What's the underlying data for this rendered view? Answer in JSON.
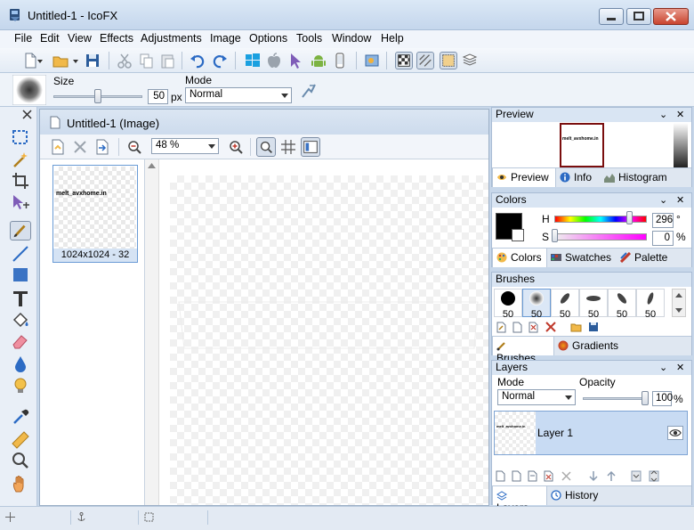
{
  "window": {
    "title": "Untitled-1 - IcoFX"
  },
  "menu": [
    "File",
    "Edit",
    "View",
    "Effects",
    "Adjustments",
    "Image",
    "Options",
    "Tools",
    "Window",
    "Help"
  ],
  "options": {
    "size_label": "Size",
    "size_value": "50",
    "size_unit": "px",
    "mode_label": "Mode",
    "mode_value": "Normal"
  },
  "document": {
    "title": "Untitled-1 (Image)",
    "zoom": "48 %",
    "thumb_caption": "1024x1024 - 32",
    "watermark": "melt_avxhome.in"
  },
  "preview": {
    "title": "Preview",
    "tabs": [
      "Preview",
      "Info",
      "Histogram"
    ],
    "watermark": "melt_avxhome.in"
  },
  "colors": {
    "title": "Colors",
    "h_label": "H",
    "h_value": "296",
    "h_unit": "°",
    "s_label": "S",
    "s_value": "0",
    "s_unit": "%",
    "tabs": [
      "Colors",
      "Swatches",
      "Palette"
    ],
    "primary": "#000000"
  },
  "brushes": {
    "title": "Brushes",
    "sizes": [
      "50",
      "50",
      "50",
      "50",
      "50",
      "50"
    ],
    "tabs": [
      "Brushes",
      "Gradients"
    ]
  },
  "layers": {
    "title": "Layers",
    "mode_label": "Mode",
    "mode_value": "Normal",
    "opacity_label": "Opacity",
    "opacity_value": "100",
    "opacity_unit": "%",
    "items": [
      {
        "name": "Layer 1",
        "thumb_text": "melt_avxhome.in"
      }
    ],
    "tabs": [
      "Layers",
      "History"
    ]
  }
}
